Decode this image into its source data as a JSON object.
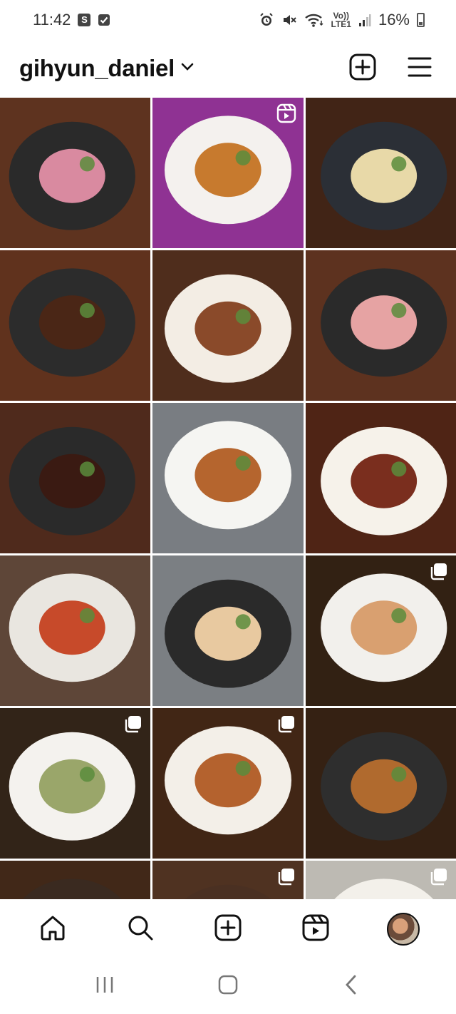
{
  "status_bar": {
    "time": "11:42",
    "left_icons": [
      "s-app-icon",
      "checkbox-notification-icon"
    ],
    "right_icons": [
      "alarm-icon",
      "mute-icon",
      "wifi-icon",
      "volte-icon",
      "signal-icon"
    ],
    "volte_top": "Vo))",
    "volte_bottom": "LTE1",
    "battery_percent": "16%"
  },
  "header": {
    "username": "gihyun_daniel",
    "icons": [
      "chevron-down-icon",
      "create-post-icon",
      "menu-icon"
    ]
  },
  "grid": {
    "posts": [
      {
        "type": "photo",
        "bg": "#6b3b24",
        "plate": "#2a2a2a",
        "food": "#d98aa0",
        "badge": ""
      },
      {
        "type": "reel",
        "bg": "#a33aa8",
        "plate": "#f4f1ee",
        "food": "#c77a2e",
        "badge": "reel-icon"
      },
      {
        "type": "photo",
        "bg": "#4a2a1a",
        "plate": "#2b2f36",
        "food": "#e8d9a8",
        "badge": ""
      },
      {
        "type": "photo",
        "bg": "#6e3a22",
        "plate": "#2c2c2c",
        "food": "#4a2616",
        "badge": ""
      },
      {
        "type": "photo",
        "bg": "#5a3420",
        "plate": "#f3ede4",
        "food": "#8a4a2a",
        "badge": ""
      },
      {
        "type": "photo",
        "bg": "#6a3a24",
        "plate": "#2a2a2a",
        "food": "#e6a3a3",
        "badge": ""
      },
      {
        "type": "photo",
        "bg": "#5b3020",
        "plate": "#2a2a2a",
        "food": "#3a1a12",
        "badge": ""
      },
      {
        "type": "photo",
        "bg": "#8a8f94",
        "plate": "#f5f5f2",
        "food": "#b5652e",
        "badge": ""
      },
      {
        "type": "photo",
        "bg": "#5a2a18",
        "plate": "#f6f2ea",
        "food": "#7a2e1e",
        "badge": ""
      },
      {
        "type": "photo",
        "bg": "#6b5040",
        "plate": "#e9e6e0",
        "food": "#c74a2a",
        "badge": ""
      },
      {
        "type": "photo",
        "bg": "#8c9196",
        "plate": "#2a2a2a",
        "food": "#e8c9a0",
        "badge": ""
      },
      {
        "type": "carousel",
        "bg": "#3a2616",
        "plate": "#f2f0ec",
        "food": "#d9a070",
        "badge": "carousel-icon"
      },
      {
        "type": "carousel",
        "bg": "#3a2a1c",
        "plate": "#f4f2ee",
        "food": "#9aa66a",
        "badge": "carousel-icon"
      },
      {
        "type": "carousel",
        "bg": "#4a2c18",
        "plate": "#f3efe8",
        "food": "#b4622e",
        "badge": "carousel-icon"
      },
      {
        "type": "photo",
        "bg": "#3d2616",
        "plate": "#2e2e2e",
        "food": "#b06a2e",
        "badge": ""
      },
      {
        "type": "photo",
        "bg": "#4a2e1c",
        "plate": "#3a2a20",
        "food": "#d8c0a0",
        "badge": ""
      },
      {
        "type": "carousel",
        "bg": "#5a3a26",
        "plate": "#4a3022",
        "food": "#6a4030",
        "badge": "carousel-icon"
      },
      {
        "type": "carousel",
        "bg": "#d8d4cc",
        "plate": "#f3f0ea",
        "food": "#8a9a4a",
        "badge": "carousel-icon"
      }
    ]
  },
  "bottom_nav": {
    "items": [
      "home-icon",
      "search-icon",
      "create-icon",
      "reels-icon",
      "profile-avatar"
    ]
  },
  "system_nav": {
    "items": [
      "recent-apps-icon",
      "home-button-icon",
      "back-icon"
    ]
  }
}
